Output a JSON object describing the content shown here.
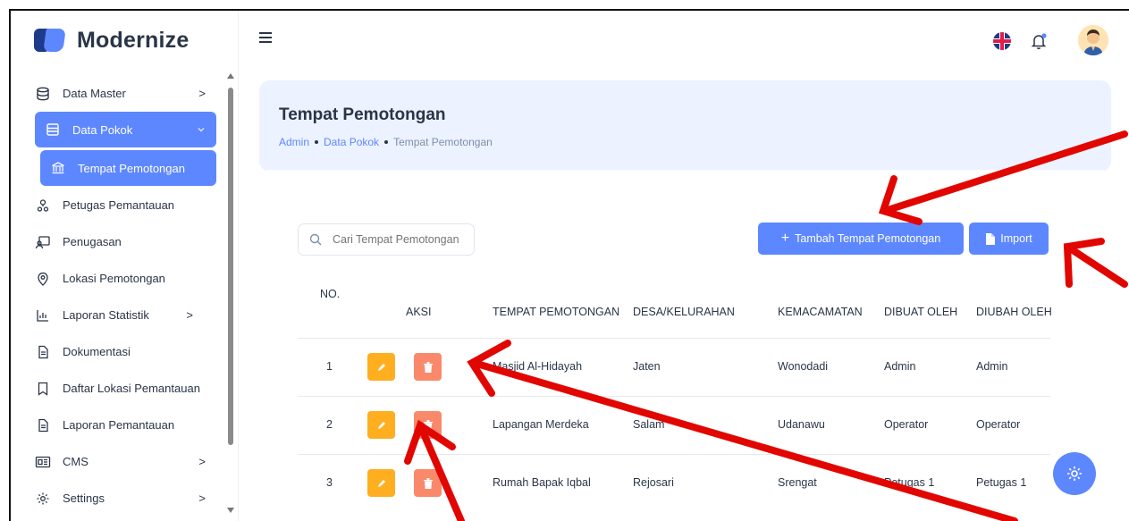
{
  "app": {
    "name": "Modernize"
  },
  "sidebar": {
    "items": [
      {
        "label": "Data Master",
        "icon": "database-icon",
        "chevron": ">"
      },
      {
        "label": "Data Pokok",
        "icon": "table-icon",
        "chevron": "v",
        "active": true
      },
      {
        "label": "Tempat Pemotongan",
        "icon": "bank-icon",
        "sub_active": true
      },
      {
        "label": "Petugas Pemantauan",
        "icon": "users-icon"
      },
      {
        "label": "Penugasan",
        "icon": "assignment-icon"
      },
      {
        "label": "Lokasi Pemotongan",
        "icon": "map-pin-icon"
      },
      {
        "label": "Laporan Statistik",
        "icon": "chart-icon",
        "chevron": ">"
      },
      {
        "label": "Dokumentasi",
        "icon": "file-icon"
      },
      {
        "label": "Daftar Lokasi Pemantauan",
        "icon": "bookmark-icon"
      },
      {
        "label": "Laporan Pemantauan",
        "icon": "file-icon"
      },
      {
        "label": "CMS",
        "icon": "layout-icon",
        "chevron": ">"
      },
      {
        "label": "Settings",
        "icon": "settings-icon",
        "chevron": ">"
      }
    ]
  },
  "header": {
    "title": "Tempat Pemotongan",
    "breadcrumb": [
      "Admin",
      "Data Pokok",
      "Tempat Pemotongan"
    ]
  },
  "toolbar": {
    "search_placeholder": "Cari Tempat Pemotongan",
    "add_label": "Tambah Tempat Pemotongan",
    "import_label": "Import"
  },
  "table": {
    "columns": [
      "NO.",
      "AKSI",
      "TEMPAT PEMOTONGAN",
      "DESA/KELURAHAN",
      "KEMACAMATAN",
      "DIBUAT OLEH",
      "DIUBAH OLEH"
    ],
    "rows": [
      {
        "no": "1",
        "tempat": "Masjid Al-Hidayah",
        "desa": "Jaten",
        "kecamatan": "Wonodadi",
        "dibuat": "Admin",
        "diubah": "Admin"
      },
      {
        "no": "2",
        "tempat": "Lapangan Merdeka",
        "desa": "Salam",
        "kecamatan": "Udanawu",
        "dibuat": "Operator",
        "diubah": "Operator"
      },
      {
        "no": "3",
        "tempat": "Rumah Bapak Iqbal",
        "desa": "Rejosari",
        "kecamatan": "Srengat",
        "dibuat": "Petugas 1",
        "diubah": "Petugas 1"
      }
    ]
  },
  "colors": {
    "primary": "#5d87ff",
    "edit": "#ffae1f",
    "delete": "#fa896b",
    "annotation": "#e10600"
  }
}
